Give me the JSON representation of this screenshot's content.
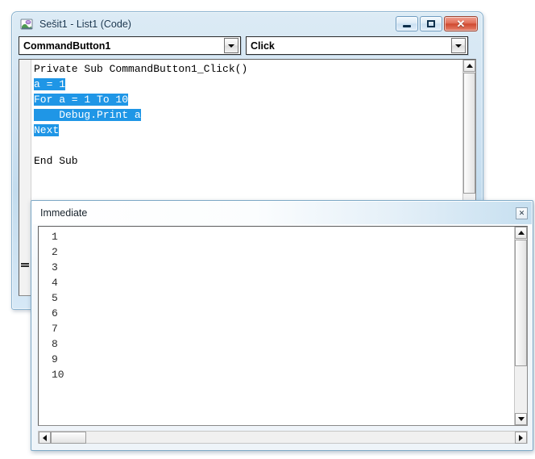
{
  "code_window": {
    "title": "Sešit1 - List1 (Code)",
    "icon": "excel-vba-sheet-icon",
    "window_buttons": {
      "minimize": "minimize-icon",
      "restore": "restore-icon",
      "close": "✕"
    },
    "object_dropdown": {
      "value": "CommandButton1",
      "arrow": "chevron-down-icon"
    },
    "procedure_dropdown": {
      "value": "Click",
      "arrow": "chevron-down-icon"
    },
    "code_lines": [
      {
        "segments": [
          {
            "text": "Private Sub CommandButton1_Click()",
            "selected": false
          }
        ]
      },
      {
        "segments": [
          {
            "text": "a = 1",
            "selected": true
          }
        ]
      },
      {
        "segments": [
          {
            "text": "For a = 1 To 10",
            "selected": true
          }
        ]
      },
      {
        "segments": [
          {
            "text": "    Debug.Print a",
            "selected": true
          }
        ]
      },
      {
        "segments": [
          {
            "text": "Next",
            "selected": true
          }
        ]
      },
      {
        "segments": [
          {
            "text": "",
            "selected": false
          }
        ]
      },
      {
        "segments": [
          {
            "text": "End Sub",
            "selected": false
          }
        ]
      }
    ],
    "selection_color": "#1f96e6",
    "scrollbar": {
      "up_arrow": "scroll-up-arrow-icon",
      "down_arrow": "scroll-down-arrow-icon"
    }
  },
  "immediate_window": {
    "title": "Immediate",
    "close_label": "✕",
    "output_lines": [
      "1",
      "2",
      "3",
      "4",
      "5",
      "6",
      "7",
      "8",
      "9",
      "10"
    ],
    "scrollbar": {
      "up_arrow": "scroll-up-arrow-icon",
      "down_arrow": "scroll-down-arrow-icon",
      "left_arrow": "scroll-left-arrow-icon",
      "right_arrow": "scroll-right-arrow-icon"
    }
  }
}
